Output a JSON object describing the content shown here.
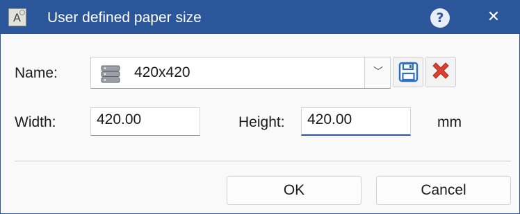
{
  "window": {
    "title": "User defined paper size"
  },
  "titlebar": {
    "help_glyph": "?",
    "close_glyph": "✕"
  },
  "name": {
    "label": "Name:",
    "value": "420x420",
    "icon": "database-icon"
  },
  "tools": {
    "save_icon": "save-icon",
    "delete_icon": "delete-icon"
  },
  "width": {
    "label": "Width:",
    "value": "420.00"
  },
  "height": {
    "label": "Height:",
    "value": "420.00"
  },
  "unit": "mm",
  "buttons": {
    "ok": "OK",
    "cancel": "Cancel"
  },
  "colors": {
    "titlebar": "#2b579a",
    "save_blue": "#2f6fc2",
    "delete_red": "#d9432f"
  }
}
